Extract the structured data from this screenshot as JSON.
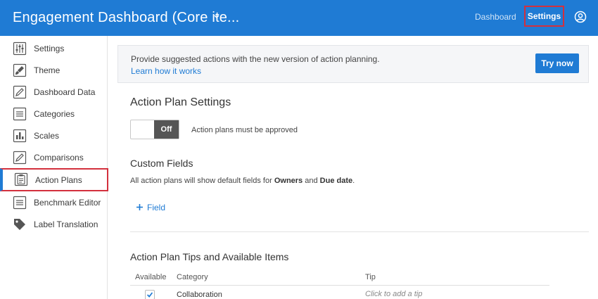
{
  "header": {
    "title": "Engagement Dashboard (Core ite...",
    "nav_dashboard": "Dashboard",
    "nav_settings": "Settings",
    "accent_color": "#1f7bd4",
    "highlight_color": "#d3303d"
  },
  "sidebar": {
    "items": [
      {
        "label": "Settings",
        "icon": "sliders-icon"
      },
      {
        "label": "Theme",
        "icon": "paintbrush-icon"
      },
      {
        "label": "Dashboard Data",
        "icon": "pencil-icon"
      },
      {
        "label": "Categories",
        "icon": "list-icon"
      },
      {
        "label": "Scales",
        "icon": "bar-chart-icon"
      },
      {
        "label": "Comparisons",
        "icon": "pencil-icon"
      },
      {
        "label": "Action Plans",
        "icon": "clipboard-icon",
        "active": true
      },
      {
        "label": "Benchmark Editor",
        "icon": "list-icon"
      },
      {
        "label": "Label Translation",
        "icon": "tag-icon"
      }
    ]
  },
  "banner": {
    "text": "Provide suggested actions with the new version of action planning.",
    "link": "Learn how it works",
    "button": "Try now"
  },
  "action_plan_settings": {
    "title": "Action Plan Settings",
    "toggle_state": "Off",
    "toggle_label": "Action plans must be approved"
  },
  "custom_fields": {
    "title": "Custom Fields",
    "desc_prefix": "All action plans will show default fields for ",
    "desc_owners": "Owners",
    "desc_and": " and ",
    "desc_due": "Due date",
    "desc_suffix": ".",
    "add_field": "Field"
  },
  "tips": {
    "title": "Action Plan Tips and Available Items",
    "columns": [
      "Available",
      "Category",
      "Tip"
    ],
    "rows": [
      {
        "available": true,
        "category": "Collaboration",
        "tip": "Click to add a tip"
      }
    ]
  }
}
